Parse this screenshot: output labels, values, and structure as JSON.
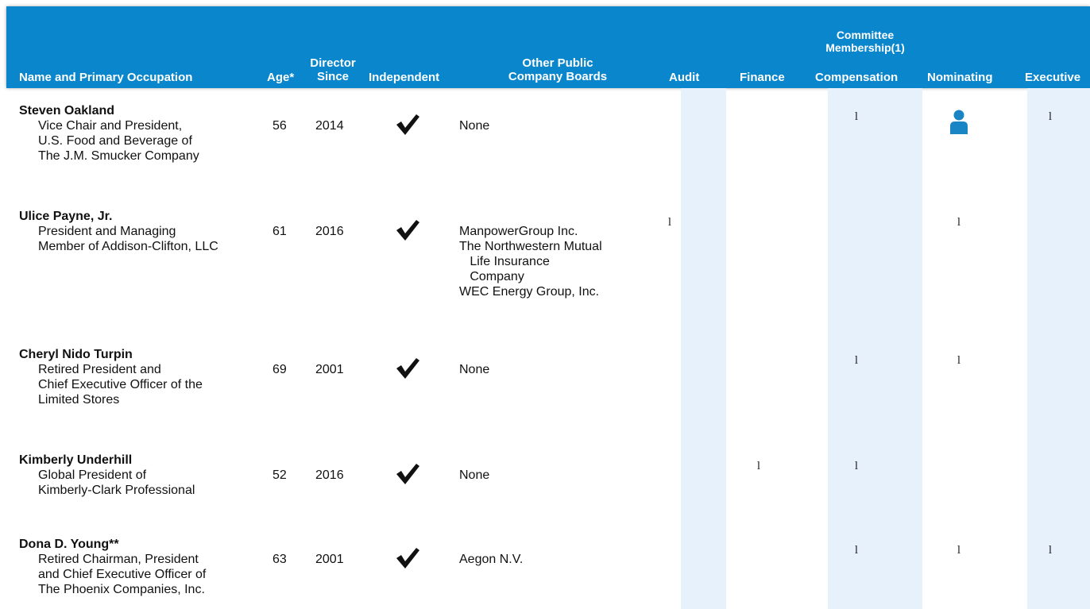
{
  "header": {
    "name": "Name and Primary Occupation",
    "age": "Age*",
    "director_since": "Director Since",
    "independent": "Independent",
    "other_boards": "Other Public Company Boards",
    "committee_group": "Committee Membership(1)",
    "committees": [
      "Audit",
      "Finance",
      "Compensation",
      "Nominating",
      "Executive"
    ]
  },
  "committee_marker": "l",
  "colors": {
    "header_bg": "#0a86cc",
    "shade": "#e7f1fb",
    "chair_icon": "#1a85c4"
  },
  "directors": [
    {
      "name": "Steven Oakland",
      "occupation": [
        "Vice Chair and President,",
        "U.S. Food and Beverage of",
        "The J.M. Smucker Company"
      ],
      "age": "56",
      "since": "2014",
      "independent": true,
      "boards": [
        "None"
      ],
      "committees": {
        "audit": "",
        "finance": "",
        "compensation": "member",
        "nominating": "chair",
        "executive": "member"
      }
    },
    {
      "name": "Ulice Payne, Jr.",
      "occupation": [
        "President and Managing",
        "Member of Addison-Clifton, LLC"
      ],
      "age": "61",
      "since": "2016",
      "independent": true,
      "boards": [
        "ManpowerGroup Inc.",
        "The Northwestern Mutual",
        "   Life Insurance",
        "   Company",
        "WEC Energy Group, Inc."
      ],
      "committees": {
        "audit": "member",
        "finance": "",
        "compensation": "",
        "nominating": "member",
        "executive": ""
      }
    },
    {
      "name": "Cheryl Nido Turpin",
      "occupation": [
        "Retired President and",
        "Chief Executive Officer of the",
        "Limited Stores"
      ],
      "age": "69",
      "since": "2001",
      "independent": true,
      "boards": [
        "None"
      ],
      "committees": {
        "audit": "",
        "finance": "",
        "compensation": "member",
        "nominating": "member",
        "executive": ""
      }
    },
    {
      "name": "Kimberly Underhill",
      "occupation": [
        "Global President of",
        "Kimberly-Clark Professional"
      ],
      "age": "52",
      "since": "2016",
      "independent": true,
      "boards": [
        "None"
      ],
      "committees": {
        "audit": "",
        "finance": "member",
        "compensation": "member",
        "nominating": "",
        "executive": ""
      }
    },
    {
      "name": "Dona D. Young**",
      "occupation": [
        "Retired Chairman, President",
        "and Chief Executive Officer of",
        "The Phoenix Companies, Inc."
      ],
      "age": "63",
      "since": "2001",
      "independent": true,
      "boards": [
        "Aegon N.V."
      ],
      "committees": {
        "audit": "",
        "finance": "",
        "compensation": "member",
        "nominating": "member",
        "executive": "member"
      }
    }
  ]
}
